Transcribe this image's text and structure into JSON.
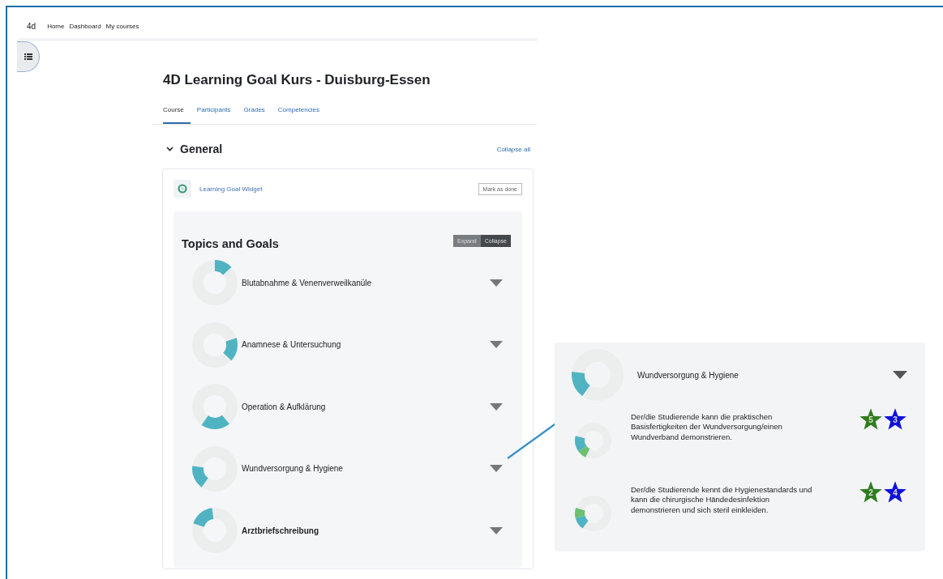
{
  "nav": {
    "brand": "4d",
    "links": [
      "Home",
      "Dashboard",
      "My courses"
    ]
  },
  "course": {
    "title": "4D Learning Goal Kurs - Duisburg-Essen"
  },
  "tabs": [
    {
      "label": "Course",
      "selected": true
    },
    {
      "label": "Participants",
      "selected": false
    },
    {
      "label": "Grades",
      "selected": false
    },
    {
      "label": "Competencies",
      "selected": false
    }
  ],
  "section": {
    "title": "General",
    "expanded": true,
    "collapse_all": "Collapse all"
  },
  "activity": {
    "name": "Learning Goal Widget",
    "button": "Mark as done"
  },
  "widget": {
    "title": "Topics and Goals",
    "toggle": [
      {
        "label": "Expand",
        "selected": false
      },
      {
        "label": "Collapse",
        "selected": true
      }
    ],
    "topics": [
      {
        "name": "Blutabnahme & Venenverweilkanüle",
        "bold": false
      },
      {
        "name": "Anamnese & Untersuchung",
        "bold": false
      },
      {
        "name": "Operation & Aufklärung",
        "bold": false
      },
      {
        "name": "Wundversorgung & Hygiene",
        "bold": false
      },
      {
        "name": "Arztbriefschreibung",
        "bold": true
      }
    ]
  },
  "detail": {
    "topic": {
      "name": "Wundversorgung & Hygiene"
    },
    "goals": [
      {
        "text": "Der/die Studierende kann die praktischen Basisfertigkeiten der Wundversorgung/einen Wundverband demonstrieren.",
        "badges": [
          {
            "text": "5",
            "color": "#2f7d1f"
          },
          {
            "text": "3",
            "color": "#1010e0"
          }
        ]
      },
      {
        "text": "Der/die Studierende kennt die Hygienestandards und kann die chirurgische Händedesinfektion demonstrieren und sich steril einkleiden.",
        "badges": [
          {
            "text": "2",
            "color": "#2f7d1f"
          },
          {
            "text": "4",
            "color": "#1010e0"
          }
        ]
      }
    ]
  }
}
